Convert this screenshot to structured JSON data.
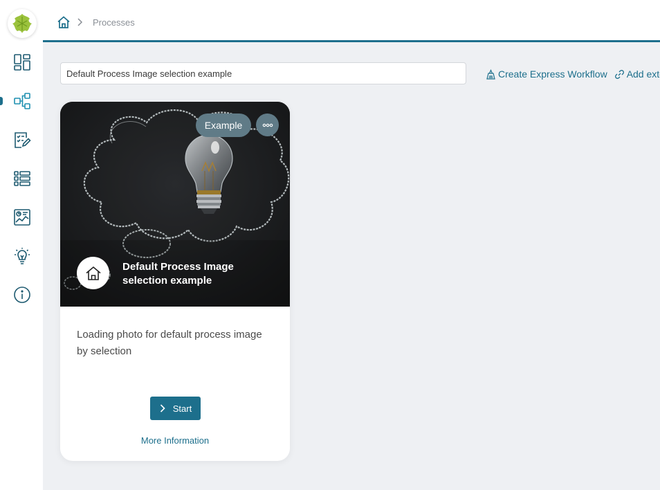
{
  "breadcrumb": {
    "current": "Processes"
  },
  "search": {
    "value": "Default Process Image selection example"
  },
  "actions": {
    "create_express_workflow": "Create Express Workflow",
    "add_external": "Add exte"
  },
  "card": {
    "tag": "Example",
    "title": "Default Process Image selection example",
    "description": "Loading photo for default process image by selection",
    "start_label": "Start",
    "more_info_label": "More Information"
  },
  "sidebar": {
    "items": [
      {
        "icon": "dashboard-icon"
      },
      {
        "icon": "processes-icon",
        "active": true
      },
      {
        "icon": "tasks-icon"
      },
      {
        "icon": "cases-list-icon"
      },
      {
        "icon": "statistics-icon"
      },
      {
        "icon": "lightbulb-icon"
      },
      {
        "icon": "info-icon"
      }
    ]
  },
  "colors": {
    "accent": "#1d6f8c",
    "tag_background": "#607b87",
    "page_background": "#eef0f3",
    "logo_leaf": "#9bc23c"
  }
}
